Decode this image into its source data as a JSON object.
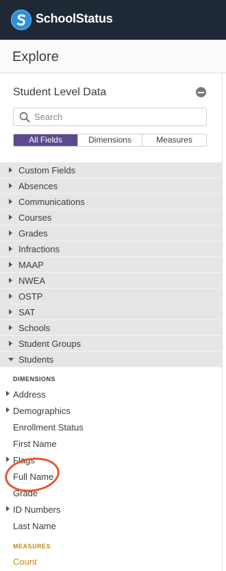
{
  "app": {
    "name": "SchoolStatus",
    "logo_letter": "S"
  },
  "page": {
    "title": "Explore"
  },
  "explore": {
    "model_title": "Student Level Data",
    "search": {
      "placeholder": "Search",
      "value": ""
    },
    "tabs": [
      {
        "label": "All Fields",
        "active": true
      },
      {
        "label": "Dimensions",
        "active": false
      },
      {
        "label": "Measures",
        "active": false
      }
    ],
    "views": [
      {
        "label": "Custom Fields",
        "expanded": false
      },
      {
        "label": "Absences",
        "expanded": false
      },
      {
        "label": "Communications",
        "expanded": false
      },
      {
        "label": "Courses",
        "expanded": false
      },
      {
        "label": "Grades",
        "expanded": false
      },
      {
        "label": "Infractions",
        "expanded": false
      },
      {
        "label": "MAAP",
        "expanded": false
      },
      {
        "label": "NWEA",
        "expanded": false
      },
      {
        "label": "OSTP",
        "expanded": false
      },
      {
        "label": "SAT",
        "expanded": false
      },
      {
        "label": "Schools",
        "expanded": false
      },
      {
        "label": "Student Groups",
        "expanded": false
      },
      {
        "label": "Students",
        "expanded": true
      }
    ],
    "students": {
      "dimensions_heading": "DIMENSIONS",
      "dimensions": [
        {
          "label": "Address",
          "group": true
        },
        {
          "label": "Demographics",
          "group": true
        },
        {
          "label": "Enrollment Status",
          "group": false
        },
        {
          "label": "First Name",
          "group": false
        },
        {
          "label": "Flags",
          "group": true
        },
        {
          "label": "Full Name",
          "group": false,
          "highlighted": true
        },
        {
          "label": "Grade",
          "group": false
        },
        {
          "label": "ID Numbers",
          "group": true
        },
        {
          "label": "Last Name",
          "group": false
        }
      ],
      "measures_heading": "MEASURES",
      "measures": [
        {
          "label": "Count"
        }
      ]
    }
  },
  "colors": {
    "topbar": "#1f2835",
    "active_tab": "#5b4a8f",
    "measure": "#c5891e",
    "annotation": "#e9532e"
  },
  "icons": [
    "schoolstatus-logo-icon",
    "minus-circle-icon",
    "search-icon",
    "caret-right-icon",
    "caret-down-icon"
  ]
}
